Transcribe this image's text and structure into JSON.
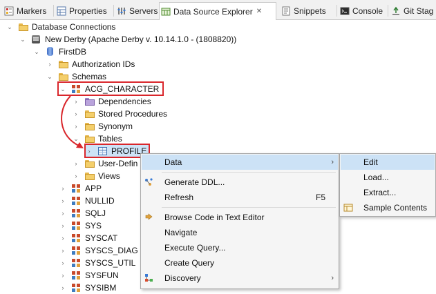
{
  "tabs": [
    {
      "label": "Markers",
      "icon": "markers-icon"
    },
    {
      "label": "Properties",
      "icon": "properties-icon"
    },
    {
      "label": "Servers",
      "icon": "servers-icon"
    },
    {
      "label": "Data Source Explorer",
      "icon": "data-source-explorer-icon",
      "active": true
    },
    {
      "label": "Snippets",
      "icon": "snippets-icon"
    },
    {
      "label": "Console",
      "icon": "console-icon"
    },
    {
      "label": "Git Stag",
      "icon": "git-staging-icon"
    }
  ],
  "tree": {
    "database_connections": "Database Connections",
    "new_derby": "New Derby (Apache Derby v. 10.14.1.0 - (1808820))",
    "firstdb": "FirstDB",
    "authorization_ids": "Authorization IDs",
    "schemas": "Schemas",
    "acg_character": "ACG_CHARACTER",
    "dependencies": "Dependencies",
    "stored_procedures": "Stored Procedures",
    "synonym": "Synonym",
    "tables": "Tables",
    "profile": "PROFILE",
    "user_defined": "User-Defin",
    "views": "Views",
    "other_schemas": [
      "APP",
      "NULLID",
      "SQLJ",
      "SYS",
      "SYSCAT",
      "SYSCS_DIAG",
      "SYSCS_UTIL",
      "SYSFUN",
      "SYSIBM"
    ]
  },
  "context_menu": {
    "items": [
      {
        "label": "Data",
        "submenu": true,
        "icon": ""
      },
      {
        "label": "Generate DDL...",
        "icon": "generate-ddl-icon"
      },
      {
        "label": "Refresh",
        "shortcut": "F5",
        "icon": ""
      },
      {
        "label": "Browse Code in Text Editor",
        "icon": "browse-code-icon"
      },
      {
        "label": "Navigate",
        "icon": ""
      },
      {
        "label": "Execute Query...",
        "icon": ""
      },
      {
        "label": "Create Query",
        "icon": ""
      },
      {
        "label": "Discovery",
        "submenu": true,
        "icon": "discovery-icon"
      }
    ],
    "submenu_arrow": "›"
  },
  "data_submenu": {
    "items": [
      {
        "label": "Edit"
      },
      {
        "label": "Load..."
      },
      {
        "label": "Extract..."
      },
      {
        "label": "Sample Contents",
        "icon": "sample-contents-icon"
      }
    ]
  },
  "colors": {
    "highlight_box": "#d9262b",
    "menu_hover": "#cce2f6",
    "selection": "#cde3f7"
  }
}
